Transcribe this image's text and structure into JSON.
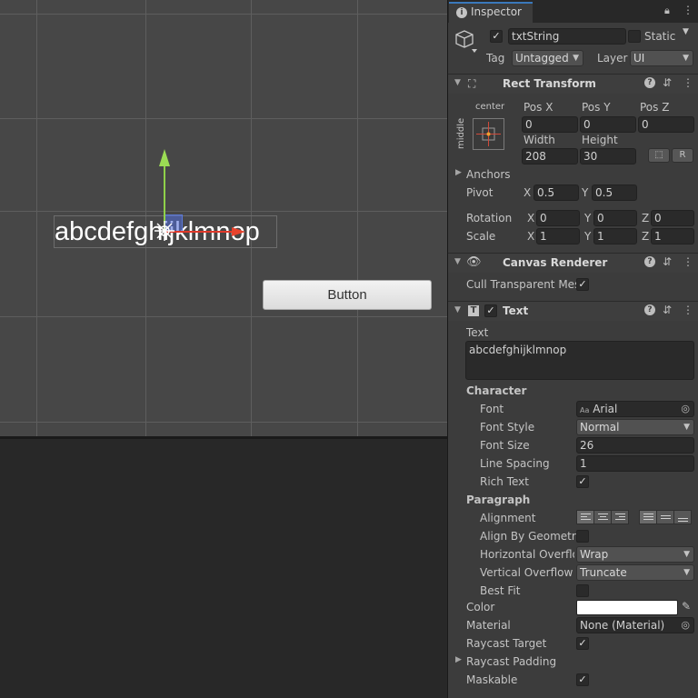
{
  "scene": {
    "text_content": "abcdefghijklmnop",
    "button_label": "Button"
  },
  "inspector": {
    "tab_label": "Inspector",
    "object_name": "txtString",
    "static_label": "Static",
    "tag_label": "Tag",
    "tag_value": "Untagged",
    "layer_label": "Layer",
    "layer_value": "UI"
  },
  "rect_transform": {
    "title": "Rect Transform",
    "anchor_preset_h": "center",
    "anchor_preset_v": "middle",
    "pos_x_label": "Pos X",
    "pos_y_label": "Pos Y",
    "pos_z_label": "Pos Z",
    "pos_x": "0",
    "pos_y": "0",
    "pos_z": "0",
    "width_label": "Width",
    "height_label": "Height",
    "width": "208",
    "height": "30",
    "r_button": "R",
    "anchors_label": "Anchors",
    "pivot_label": "Pivot",
    "pivot_x": "0.5",
    "pivot_y": "0.5",
    "rotation_label": "Rotation",
    "rot_x": "0",
    "rot_y": "0",
    "rot_z": "0",
    "scale_label": "Scale",
    "scale_x": "1",
    "scale_y": "1",
    "scale_z": "1",
    "x": "X",
    "y": "Y",
    "z": "Z"
  },
  "canvas_renderer": {
    "title": "Canvas Renderer",
    "cull_label": "Cull Transparent Mes"
  },
  "text_component": {
    "title": "Text",
    "text_label": "Text",
    "text_value": "abcdefghijklmnop",
    "character_label": "Character",
    "font_label": "Font",
    "font_value": "Arial",
    "font_icon_text": "Aa",
    "font_style_label": "Font Style",
    "font_style_value": "Normal",
    "font_size_label": "Font Size",
    "font_size_value": "26",
    "line_spacing_label": "Line Spacing",
    "line_spacing_value": "1",
    "rich_text_label": "Rich Text",
    "paragraph_label": "Paragraph",
    "alignment_label": "Alignment",
    "align_geometry_label": "Align By Geometry",
    "h_overflow_label": "Horizontal Overflo",
    "h_overflow_value": "Wrap",
    "v_overflow_label": "Vertical Overflow",
    "v_overflow_value": "Truncate",
    "best_fit_label": "Best Fit",
    "color_label": "Color",
    "color_value": "#ffffff",
    "material_label": "Material",
    "material_value": "None (Material)",
    "raycast_target_label": "Raycast Target",
    "raycast_padding_label": "Raycast Padding",
    "maskable_label": "Maskable"
  }
}
